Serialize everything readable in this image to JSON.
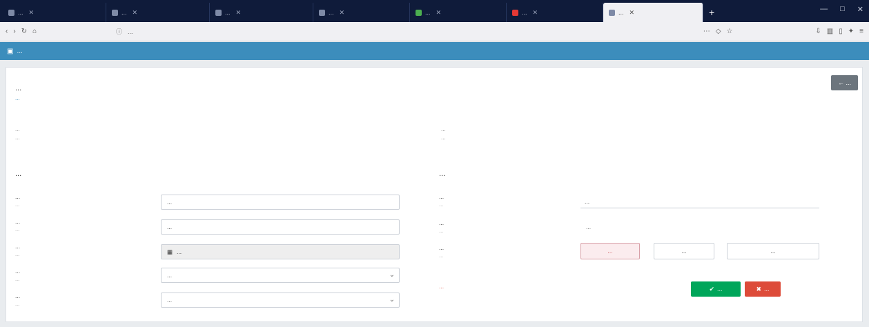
{
  "browser": {
    "tabs": [
      {
        "label": "...",
        "active": false
      },
      {
        "label": "...",
        "active": false
      },
      {
        "label": "...",
        "active": false
      },
      {
        "label": "...",
        "active": false
      },
      {
        "label": "...",
        "active": false
      },
      {
        "label": "...",
        "active": false
      },
      {
        "label": "...",
        "active": true
      }
    ],
    "url": "...",
    "new_tab": "+"
  },
  "app": {
    "brand": "..."
  },
  "page": {
    "back_button": "...",
    "title": "...",
    "subtitle": "...",
    "note_left_1": "...",
    "note_left_2": "...",
    "note_right_1": "...",
    "note_right_2": "..."
  },
  "left_section": {
    "title": "...",
    "fields": [
      {
        "label": "...",
        "sub": "...",
        "value": "..."
      },
      {
        "label": "...",
        "sub": "...",
        "value": "..."
      },
      {
        "label": "...",
        "sub": "...",
        "value": "..."
      },
      {
        "label": "...",
        "sub": "...",
        "value": "..."
      },
      {
        "label": "...",
        "sub": "...",
        "value": "..."
      }
    ]
  },
  "right_section": {
    "title": "...",
    "email": {
      "label": "...",
      "sub": "...",
      "value": "..."
    },
    "phone": {
      "label": "...",
      "sub": "...",
      "value": "..."
    },
    "code": {
      "label": "...",
      "sub": "...",
      "captcha": "...",
      "input": "...",
      "refresh": "..."
    },
    "error": "...",
    "submit": "...",
    "reset": "..."
  },
  "colors": {
    "accent": "#3c8dbc",
    "success": "#00a65a",
    "danger": "#dd4b39"
  }
}
